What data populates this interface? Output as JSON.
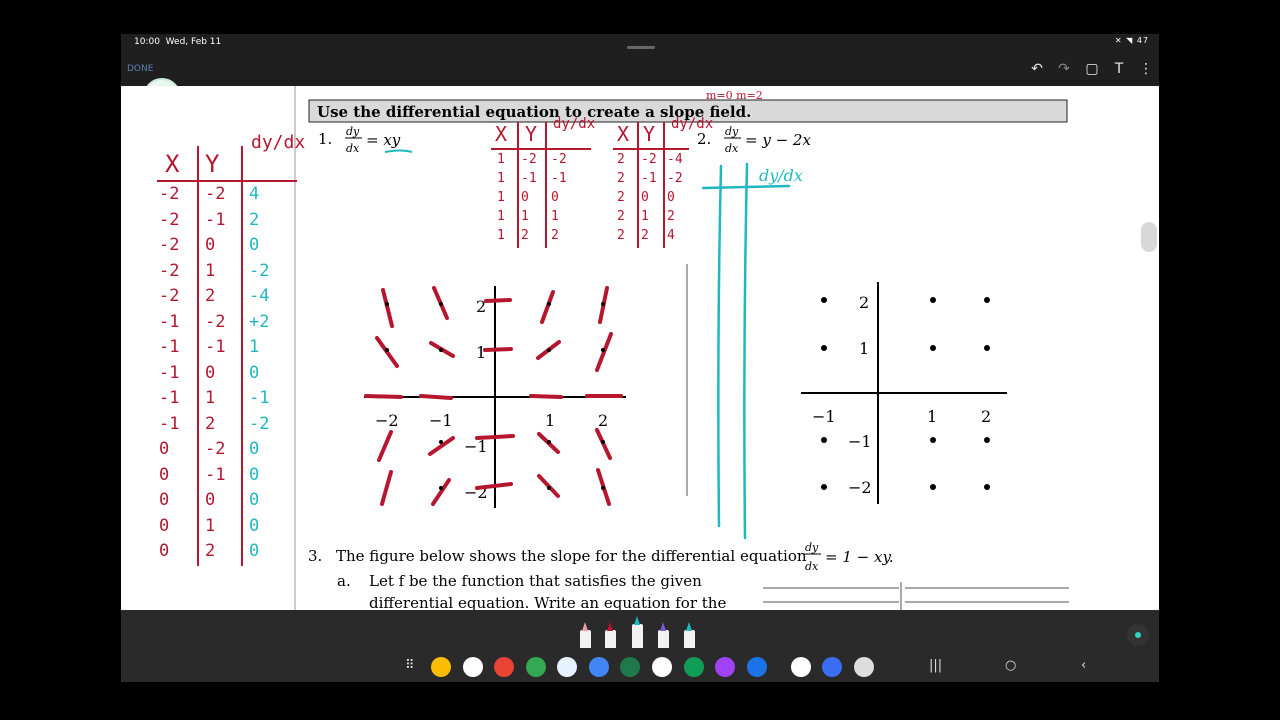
{
  "status_bar": {
    "time": "10:00",
    "date": "Wed, Feb 11",
    "system_icons": "✕ ◥ 47"
  },
  "toolbar": {
    "done_label": "DONE",
    "app_icon_name": "calculator-icon",
    "undo_icon": "undo-icon",
    "redo_icon": "redo-icon",
    "page_icon": "page-edit-icon",
    "text_icon": "text-tool-icon",
    "more_icon": "more-vert-icon"
  },
  "worksheet": {
    "banner": "Use the differential equation to create a slope field.",
    "q1_number": "1.",
    "q1_rhs": "= xy",
    "q2_number": "2.",
    "q2_rhs": "= y − 2x",
    "dy": "dy",
    "dx": "dx",
    "q3_number": "3.",
    "q3_text": "The figure below shows the slope for the differential equation",
    "q3_rhs": "= 1 − xy.",
    "q3a_label": "a.",
    "q3a_line1": "Let f be the function that satisfies the given",
    "q3a_line2": "differential equation.  Write an equation for the",
    "axis_ticks": {
      "x_neg2": "−2",
      "x_neg1": "−1",
      "x_1": "1",
      "x_2": "2",
      "y_2": "2",
      "y_1": "1",
      "y_neg1": "−1",
      "y_neg2": "−2"
    }
  },
  "handwriting": {
    "left_table_header": [
      "X",
      "Y",
      "dy/dx"
    ],
    "left_table_x": [
      "-2",
      "-2",
      "-2",
      "-2",
      "-2",
      "-1",
      "-1",
      "-1",
      "-1",
      "-1",
      "0",
      "0",
      "0",
      "0",
      "0"
    ],
    "left_table_y": [
      "-2",
      "-1",
      "0",
      "1",
      "2",
      "-2",
      "-1",
      "0",
      "1",
      "2",
      "-2",
      "-1",
      "0",
      "1",
      "2"
    ],
    "left_table_dydx": [
      "4",
      "2",
      "0",
      "-2",
      "-4",
      "+2",
      "1",
      "0",
      "-1",
      "-2",
      "0",
      "0",
      "0",
      "0",
      "0"
    ],
    "mid_table1_header": [
      "X",
      "Y",
      "dy/dx"
    ],
    "mid_table1_x": [
      "1",
      "1",
      "1",
      "1",
      "1"
    ],
    "mid_table1_y": [
      "-2",
      "-1",
      "0",
      "1",
      "2"
    ],
    "mid_table1_dydx": [
      "-2",
      "-1",
      "0",
      "1",
      "2"
    ],
    "mid_table2_header": [
      "X",
      "Y",
      "dy/dx"
    ],
    "mid_table2_x": [
      "2",
      "2",
      "2",
      "2",
      "2"
    ],
    "mid_table2_y": [
      "-2",
      "-1",
      "0",
      "1",
      "2"
    ],
    "mid_table2_dydx": [
      "-4",
      "-2",
      "0",
      "2",
      "4"
    ],
    "top_note": "m=0  m=2",
    "q2_col_header": "dy/dx"
  },
  "colors": {
    "ink_red": "#b5172f",
    "ink_teal": "#1fb8c2",
    "banner_bg": "#d9d9d9",
    "tablet_bg": "#1f1f1f"
  }
}
